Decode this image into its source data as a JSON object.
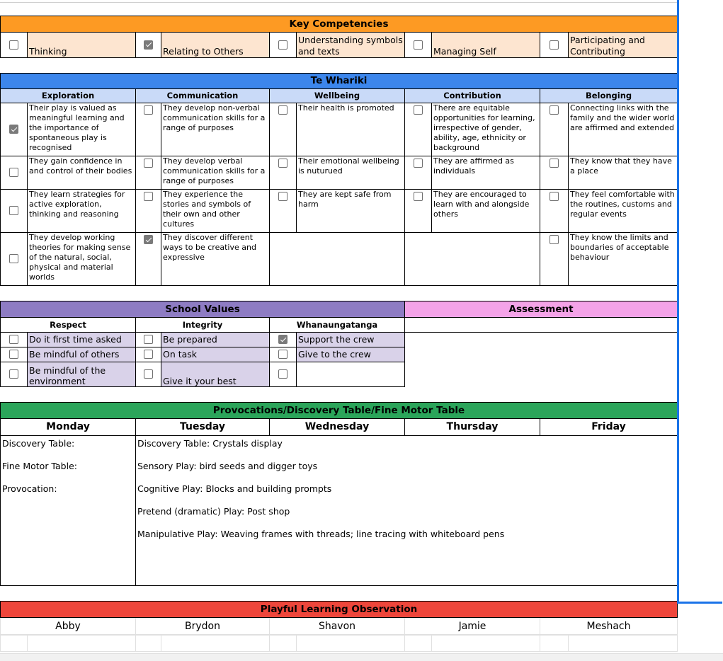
{
  "colors": {
    "key_competencies_header": "#fd9a23",
    "key_competencies_cell": "#fde5d0",
    "te_whariki_header": "#3c86ec",
    "te_whariki_subheader": "#c9daf8",
    "school_values_header": "#8e7cc3",
    "school_values_cell": "#d9d2e9",
    "assessment_header": "#f4a3e8",
    "provocations_header": "#2ba55a",
    "observation_header": "#ee463b",
    "selection_border": "#1a73e8"
  },
  "key_competencies": {
    "title": "Key Competencies",
    "items": [
      {
        "label": "Thinking",
        "checked": false
      },
      {
        "label": "Relating to Others",
        "checked": true
      },
      {
        "label": "Understanding symbols and texts",
        "checked": false
      },
      {
        "label": "Managing Self",
        "checked": false
      },
      {
        "label": "Participating and Contributing",
        "checked": false
      }
    ]
  },
  "te_whariki": {
    "title": "Te Whariki",
    "strands": [
      "Exploration",
      "Communication",
      "Wellbeing",
      "Contribution",
      "Belonging"
    ],
    "rows": [
      [
        {
          "text": "Their play is valued as meaningful learning and the importance of spontaneous play is recognised",
          "checked": true
        },
        {
          "text": "They develop non-verbal communication skills for a range of purposes",
          "checked": false
        },
        {
          "text": "Their health is promoted",
          "checked": false
        },
        {
          "text": "There are equitable opportunities for learning, irrespective of gender, ability, age, ethnicity or background",
          "checked": false
        },
        {
          "text": "Connecting links with the family and the wider world are affirmed and extended",
          "checked": false
        }
      ],
      [
        {
          "text": "They gain confidence in and control of their bodies",
          "checked": false
        },
        {
          "text": "They develop verbal communication skills for a range of purposes",
          "checked": false
        },
        {
          "text": "Their emotional wellbeing is nuturued",
          "checked": false
        },
        {
          "text": "They are affirmed as individuals",
          "checked": false
        },
        {
          "text": "They know that they have a place",
          "checked": false
        }
      ],
      [
        {
          "text": "They learn strategies for active exploration, thinking and reasoning",
          "checked": false
        },
        {
          "text": "They experience the stories and symbols of their own and other cultures",
          "checked": false
        },
        {
          "text": "They are kept safe from harm",
          "checked": false
        },
        {
          "text": "They are encouraged to learn with and alongside others",
          "checked": false
        },
        {
          "text": "They feel comfortable with the routines, customs and regular events",
          "checked": false
        }
      ],
      [
        {
          "text": "They develop working theories for making sense of the natural, social, physical and material worlds",
          "checked": false
        },
        {
          "text": "They discover different ways to be creative and expressive",
          "checked": true
        },
        null,
        null,
        {
          "text": "They know the limits and boundaries of acceptable behaviour",
          "checked": false
        }
      ]
    ]
  },
  "school_values": {
    "title": "School Values",
    "groups": [
      "Respect",
      "Integrity",
      "Whanaungatanga"
    ],
    "rows": [
      [
        {
          "text": "Do it first time asked",
          "checked": false
        },
        {
          "text": "Be prepared",
          "checked": false
        },
        {
          "text": "Support the crew",
          "checked": true
        }
      ],
      [
        {
          "text": "Be mindful of others",
          "checked": false
        },
        {
          "text": "On task",
          "checked": false
        },
        {
          "text": "Give to the crew",
          "checked": false
        }
      ],
      [
        {
          "text": "Be mindful of the environment",
          "checked": false
        },
        {
          "text": "Give it your best",
          "checked": false
        },
        {
          "text": "",
          "checked": false
        }
      ]
    ]
  },
  "assessment": {
    "title": "Assessment",
    "content": ""
  },
  "provocations": {
    "title": "Provocations/Discovery Table/Fine Motor Table",
    "days": [
      "Monday",
      "Tuesday",
      "Wednesday",
      "Thursday",
      "Friday"
    ],
    "monday_lines": [
      "Discovery Table:",
      "Fine Motor Table:",
      "Provocation:"
    ],
    "tuesday_lines": [
      "Discovery Table: Crystals display",
      "Sensory Play: bird seeds and digger toys",
      "Cognitive Play: Blocks and building prompts",
      "Pretend (dramatic) Play: Post shop",
      "Manipulative Play: Weaving frames with threads; line tracing with whiteboard pens"
    ]
  },
  "observation": {
    "title": "Playful Learning Observation",
    "children": [
      "Abby",
      "Brydon",
      "Shavon",
      "Jamie",
      "Meshach"
    ]
  }
}
